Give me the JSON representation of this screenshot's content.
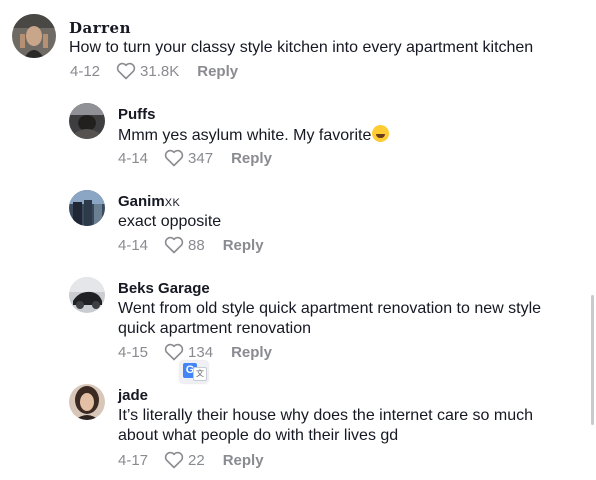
{
  "comments": [
    {
      "username": "Darren",
      "text": "How to turn your classy style kitchen into every apartment kitchen",
      "date": "4-12",
      "likes": "31.8K",
      "reply_label": "Reply"
    },
    {
      "username": "Puffs",
      "text": "Mmm yes asylum white. My favorite",
      "emoji": "grinning-sweat-emoji",
      "date": "4-14",
      "likes": "347",
      "reply_label": "Reply"
    },
    {
      "username": "Ganim",
      "username_suffix": "XK",
      "text": "exact opposite",
      "date": "4-14",
      "likes": "88",
      "reply_label": "Reply"
    },
    {
      "username": "Beks Garage",
      "text_line1": "Went from old style quick apartment renovation to new style",
      "text_line2": "quick apartment renovation",
      "date": "4-15",
      "likes": "134",
      "reply_label": "Reply"
    },
    {
      "username": "jade",
      "text_line1": "It’s literally their house why does the internet care so much",
      "text_line2": "about what people do with their lives gd",
      "date": "4-17",
      "likes": "22",
      "reply_label": "Reply"
    }
  ],
  "colors": {
    "text": "#161823",
    "meta": "#8a8b91"
  },
  "icons": {
    "like": "heart-outline-icon",
    "translate": "google-translate-icon"
  }
}
